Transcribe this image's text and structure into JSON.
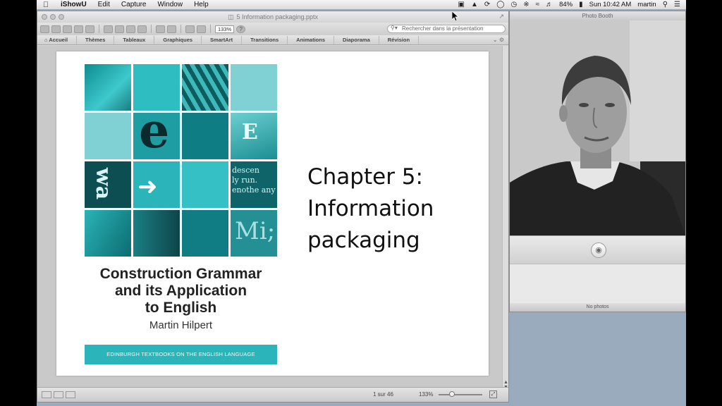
{
  "menubar": {
    "app": "iShowU",
    "items": [
      "Edit",
      "Capture",
      "Window",
      "Help"
    ],
    "battery": "84%",
    "clock": "Sun 10:42 AM",
    "user": "martin"
  },
  "ppt": {
    "title": "5 Information packaging.pptx",
    "zoom": "133%",
    "search_placeholder": "Rechercher dans la présentation",
    "tabs": [
      "Accueil",
      "Thèmes",
      "Tableaux",
      "Graphiques",
      "SmartArt",
      "Transitions",
      "Animations",
      "Diaporama",
      "Révision"
    ],
    "slide": {
      "book": {
        "title_lines": [
          "Construction Grammar",
          "and its Application",
          "to English"
        ],
        "author": "Martin Hilpert",
        "series": "EDINBURGH TEXTBOOKS ON THE ENGLISH LANGUAGE",
        "tile_glyphs": [
          "e",
          "E",
          "wa",
          "descen\nly run.\nenothe any",
          "Mi;"
        ]
      },
      "chapter_lines": [
        "Chapter 5:",
        "Information",
        "packaging"
      ]
    },
    "status": {
      "page": "1 sur 46",
      "zoom": "133%",
      "zoom_fraction": 0.33
    }
  },
  "photobooth": {
    "title": "Photo Booth",
    "status": "No photos"
  },
  "colors": {
    "teal": "#2bb5ba",
    "teal_dark": "#0c7c82",
    "teal_light": "#7fd1d3"
  }
}
